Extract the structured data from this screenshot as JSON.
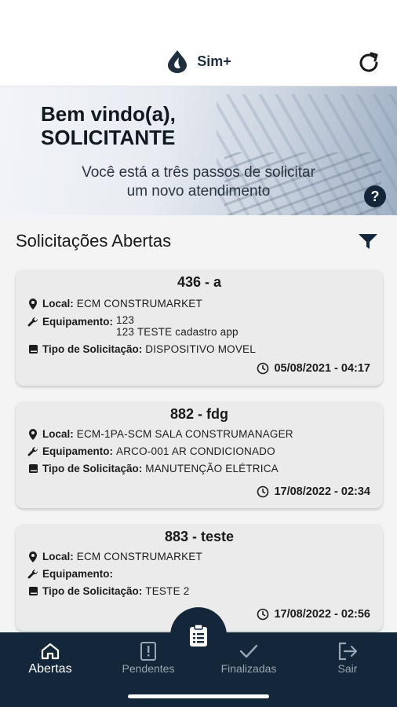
{
  "header": {
    "title": "Sim+"
  },
  "banner": {
    "greeting": "Bem vindo(a),",
    "user": "SOLICITANTE",
    "sub_line1": "Você está a três passos de solicitar",
    "sub_line2": "um novo atendimento"
  },
  "section": {
    "title": "Solicitações Abertas"
  },
  "labels": {
    "local": "Local:",
    "equipamento": "Equipamento:",
    "tipo": "Tipo de Solicitação:"
  },
  "cards": [
    {
      "title": "436 - a",
      "local": "ECM CONSTRUMARKET",
      "equip_line1": "123",
      "equip_line2": "123 TESTE cadastro app",
      "tipo": "DISPOSITIVO MOVEL",
      "date": "05/08/2021 - 04:17"
    },
    {
      "title": "882 - fdg",
      "local": "ECM-1PA-SCM SALA CONSTRUMANAGER",
      "equip_line1": "ARCO-001 AR CONDICIONADO",
      "tipo": "MANUTENÇÃO ELÉTRICA",
      "date": "17/08/2022 - 02:34"
    },
    {
      "title": "883 - teste",
      "local": "ECM CONSTRUMARKET",
      "equip_line1": "",
      "tipo": "TESTE 2",
      "date": "17/08/2022 - 02:56"
    }
  ],
  "nav": {
    "abertas": "Abertas",
    "pendentes": "Pendentes",
    "finalizadas": "Finalizadas",
    "sair": "Sair"
  },
  "colors": {
    "navy": "#14263a",
    "card": "#ebebeb"
  }
}
